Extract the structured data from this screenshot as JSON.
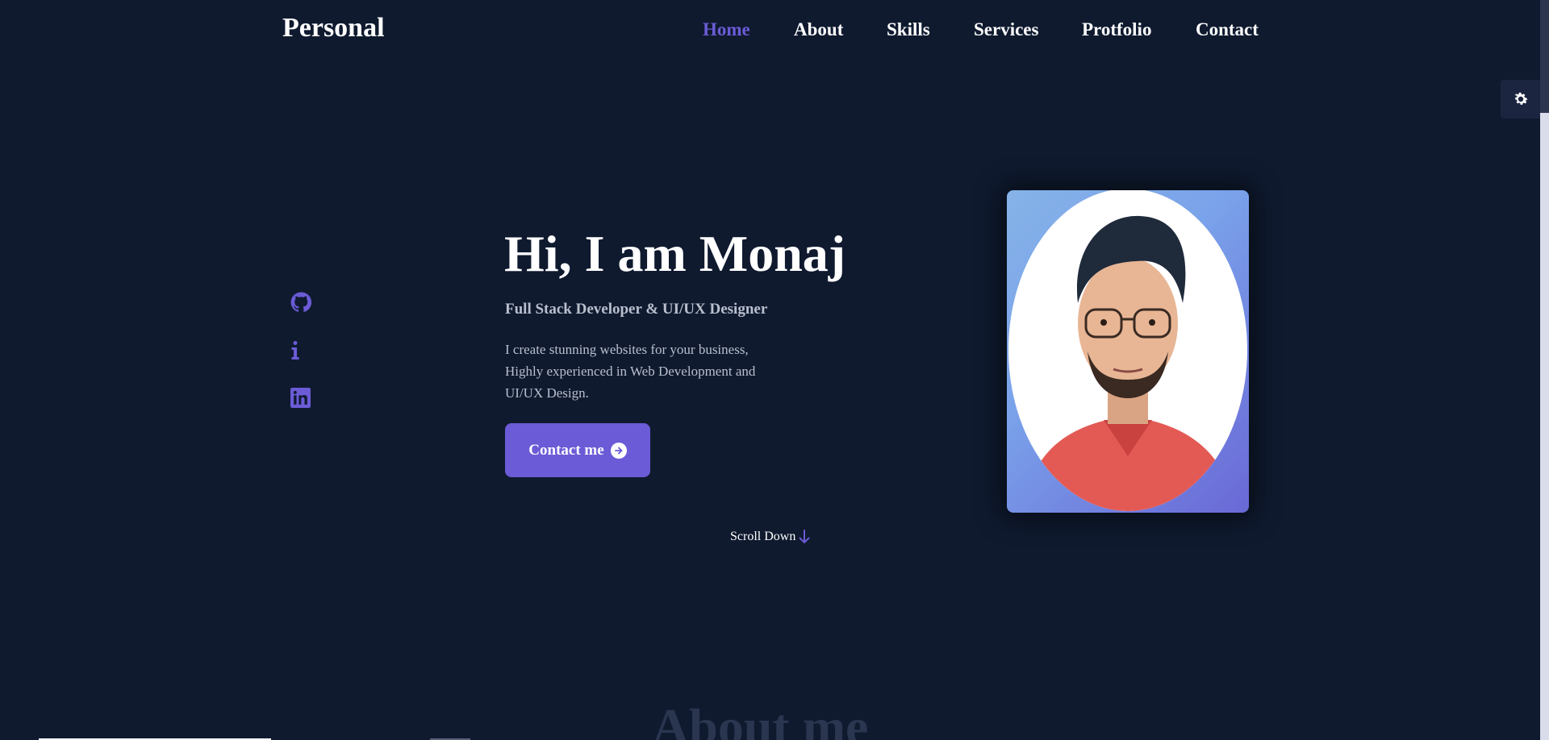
{
  "header": {
    "logo": "Personal",
    "nav": [
      {
        "label": "Home",
        "active": true
      },
      {
        "label": "About",
        "active": false
      },
      {
        "label": "Skills",
        "active": false
      },
      {
        "label": "Services",
        "active": false
      },
      {
        "label": "Protfolio",
        "active": false
      },
      {
        "label": "Contact",
        "active": false
      }
    ]
  },
  "theme_toggle": {
    "icon": "gear-icon"
  },
  "social": [
    {
      "icon": "github-icon"
    },
    {
      "icon": "info-icon"
    },
    {
      "icon": "linkedin-icon"
    }
  ],
  "hero": {
    "title": "Hi, I am Monaj",
    "subtitle": "Full Stack Developer & UI/UX Designer",
    "description": "I create stunning websites for your business, Highly experienced in Web Development and UI/UX Design.",
    "cta_label": "Contact me",
    "cta_icon": "arrow-right-circle-icon"
  },
  "scroll": {
    "label": "Scroll Down",
    "icon": "arrow-down-icon"
  },
  "about": {
    "heading": "About me"
  },
  "colors": {
    "background": "#0f1a2f",
    "accent": "#6b5bd6",
    "text": "#ffffff",
    "muted_text": "#b9bfcd"
  }
}
